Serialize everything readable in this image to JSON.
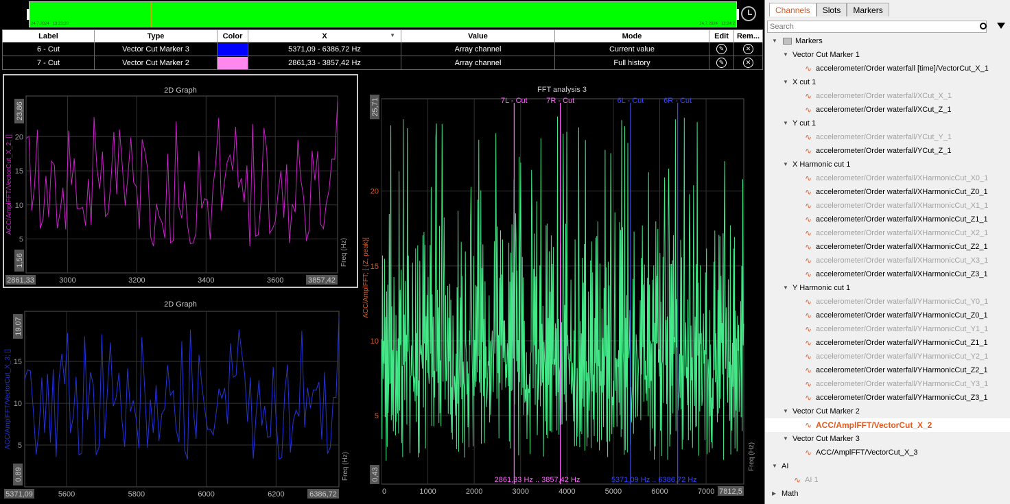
{
  "timeline": {
    "start_date": "24.7.2024",
    "start_time": "13:23:28",
    "end_date": "24.7.2024",
    "end_time": "13:24:2",
    "cursor_fraction": 0.17,
    "color": "#00ff00"
  },
  "marker_table": {
    "headers": [
      "Label",
      "Type",
      "Color",
      "X",
      "Value",
      "Mode",
      "Edit",
      "Rem..."
    ],
    "rows": [
      {
        "label": "6 - Cut",
        "type": "Vector Cut Marker 3",
        "color": "#0000ff",
        "x": "5371,09 - 6386,72 Hz",
        "value": "Array channel",
        "mode": "Current value"
      },
      {
        "label": "7 - Cut",
        "type": "Vector Cut Marker 2",
        "color": "#ff88ee",
        "x": "2861,33 - 3857,42 Hz",
        "value": "Array channel",
        "mode": "Full history"
      }
    ]
  },
  "graph1": {
    "title": "2D Graph",
    "ylabel": "ACC/AmplFFT/VectorCut_X_2; []",
    "xlabel": "Freq (Hz)",
    "ymin_label": "1,56",
    "ymax_label": "23,86",
    "xmin_label": "2861,33",
    "xmax_label": "3857,42",
    "y_ticks": [
      "5",
      "10",
      "15",
      "20"
    ],
    "x_ticks": [
      "3000",
      "3200",
      "3400",
      "3600"
    ],
    "color": "#cc22cc"
  },
  "graph2": {
    "title": "2D Graph",
    "ylabel": "ACC/AmplFFT/VectorCut_X_3; []",
    "xlabel": "Freq (Hz)",
    "ymin_label": "0,89",
    "ymax_label": "19,07",
    "xmin_label": "5371,09",
    "xmax_label": "6386,72",
    "y_ticks": [
      "5",
      "10",
      "15"
    ],
    "x_ticks": [
      "5600",
      "5800",
      "6000",
      "6200"
    ],
    "color": "#2233dd"
  },
  "fft": {
    "title": "FFT analysis 3",
    "ylabel": "ACC/AmplFFT; [ (Z, peak)]",
    "xlabel": "Freq (Hz)",
    "ymin_label": "0,43",
    "ymax_label": "25,71",
    "y_ticks": [
      "5",
      "10",
      "15",
      "20"
    ],
    "x_ticks": [
      "0",
      "1000",
      "2000",
      "3000",
      "4000",
      "5000",
      "6000",
      "7000"
    ],
    "xmax_label": "7812,5",
    "color": "#44e888",
    "markers": [
      {
        "label": "7L - Cut",
        "x": 2861.33,
        "color": "#ff66ff"
      },
      {
        "label": "7R - Cut",
        "x": 3857.42,
        "color": "#ff66ff"
      },
      {
        "label": "6L - Cut",
        "x": 5371.09,
        "color": "#3344ff"
      },
      {
        "label": "6R - Cut",
        "x": 6386.72,
        "color": "#3344ff"
      }
    ],
    "range_labels": [
      {
        "text": "2861,33 Hz .. 3857,42 Hz",
        "color": "#ff66ff"
      },
      {
        "text": "5371,09 Hz .. 6386,72 Hz",
        "color": "#3344ff"
      }
    ]
  },
  "sidebar": {
    "tabs": [
      "Channels",
      "Slots",
      "Markers"
    ],
    "active_tab": "Channels",
    "search_placeholder": "Search",
    "tree": [
      {
        "label": "Markers",
        "level": 0,
        "kind": "folder",
        "arrow": "▼"
      },
      {
        "label": "Vector Cut Marker 1",
        "level": 1,
        "kind": "group",
        "arrow": "▼"
      },
      {
        "label": "accelerometer/Order waterfall [time]/VectorCut_X_1",
        "level": 2,
        "kind": "channel"
      },
      {
        "label": "X cut 1",
        "level": 1,
        "kind": "group",
        "arrow": "▼"
      },
      {
        "label": "accelerometer/Order waterfall/XCut_X_1",
        "level": 2,
        "kind": "channel",
        "dim": true
      },
      {
        "label": "accelerometer/Order waterfall/XCut_Z_1",
        "level": 2,
        "kind": "channel"
      },
      {
        "label": "Y cut 1",
        "level": 1,
        "kind": "group",
        "arrow": "▼"
      },
      {
        "label": "accelerometer/Order waterfall/YCut_Y_1",
        "level": 2,
        "kind": "channel",
        "dim": true
      },
      {
        "label": "accelerometer/Order waterfall/YCut_Z_1",
        "level": 2,
        "kind": "channel"
      },
      {
        "label": "X Harmonic cut 1",
        "level": 1,
        "kind": "group",
        "arrow": "▼"
      },
      {
        "label": "accelerometer/Order waterfall/XHarmonicCut_X0_1",
        "level": 2,
        "kind": "channel",
        "dim": true
      },
      {
        "label": "accelerometer/Order waterfall/XHarmonicCut_Z0_1",
        "level": 2,
        "kind": "channel"
      },
      {
        "label": "accelerometer/Order waterfall/XHarmonicCut_X1_1",
        "level": 2,
        "kind": "channel",
        "dim": true
      },
      {
        "label": "accelerometer/Order waterfall/XHarmonicCut_Z1_1",
        "level": 2,
        "kind": "channel"
      },
      {
        "label": "accelerometer/Order waterfall/XHarmonicCut_X2_1",
        "level": 2,
        "kind": "channel",
        "dim": true
      },
      {
        "label": "accelerometer/Order waterfall/XHarmonicCut_Z2_1",
        "level": 2,
        "kind": "channel"
      },
      {
        "label": "accelerometer/Order waterfall/XHarmonicCut_X3_1",
        "level": 2,
        "kind": "channel",
        "dim": true
      },
      {
        "label": "accelerometer/Order waterfall/XHarmonicCut_Z3_1",
        "level": 2,
        "kind": "channel"
      },
      {
        "label": "Y Harmonic cut 1",
        "level": 1,
        "kind": "group",
        "arrow": "▼"
      },
      {
        "label": "accelerometer/Order waterfall/YHarmonicCut_Y0_1",
        "level": 2,
        "kind": "channel",
        "dim": true
      },
      {
        "label": "accelerometer/Order waterfall/YHarmonicCut_Z0_1",
        "level": 2,
        "kind": "channel"
      },
      {
        "label": "accelerometer/Order waterfall/YHarmonicCut_Y1_1",
        "level": 2,
        "kind": "channel",
        "dim": true
      },
      {
        "label": "accelerometer/Order waterfall/YHarmonicCut_Z1_1",
        "level": 2,
        "kind": "channel"
      },
      {
        "label": "accelerometer/Order waterfall/YHarmonicCut_Y2_1",
        "level": 2,
        "kind": "channel",
        "dim": true
      },
      {
        "label": "accelerometer/Order waterfall/YHarmonicCut_Z2_1",
        "level": 2,
        "kind": "channel"
      },
      {
        "label": "accelerometer/Order waterfall/YHarmonicCut_Y3_1",
        "level": 2,
        "kind": "channel",
        "dim": true
      },
      {
        "label": "accelerometer/Order waterfall/YHarmonicCut_Z3_1",
        "level": 2,
        "kind": "channel"
      },
      {
        "label": "Vector Cut Marker 2",
        "level": 1,
        "kind": "group",
        "arrow": "▼"
      },
      {
        "label": "ACC/AmplFFT/VectorCut_X_2",
        "level": 2,
        "kind": "channel",
        "selected": true
      },
      {
        "label": "Vector Cut Marker 3",
        "level": 1,
        "kind": "group",
        "arrow": "▼"
      },
      {
        "label": "ACC/AmplFFT/VectorCut_X_3",
        "level": 2,
        "kind": "channel"
      },
      {
        "label": "AI",
        "level": 0,
        "kind": "group",
        "arrow": "▼"
      },
      {
        "label": "AI 1",
        "level": 1,
        "kind": "channel",
        "dim": true
      },
      {
        "label": "Math",
        "level": 0,
        "kind": "group",
        "arrow": "▶"
      }
    ]
  }
}
